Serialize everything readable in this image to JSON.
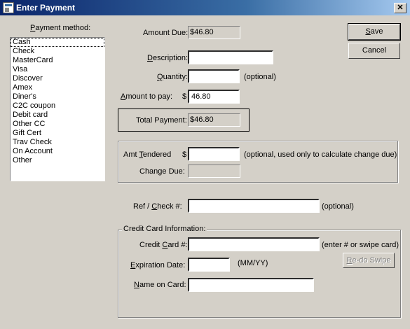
{
  "window": {
    "title": "Enter Payment",
    "close_label": "✕"
  },
  "payment_method": {
    "label": "Payment method:",
    "selected": "Cash",
    "items": [
      "Cash",
      "Check",
      "MasterCard",
      "Visa",
      "Discover",
      "Amex",
      "Diner's",
      "C2C coupon",
      "Debit card",
      "Other CC",
      "Gift Cert",
      "Trav Check",
      "On Account",
      "Other"
    ]
  },
  "amount_due": {
    "label": "Amount Due:",
    "value": "$46.80"
  },
  "description": {
    "label": "Description:",
    "value": ""
  },
  "quantity": {
    "label": "Quantity:",
    "value": "",
    "hint": "(optional)"
  },
  "amount_to_pay": {
    "label": "Amount to pay:",
    "prefix": "$",
    "value": "46.80"
  },
  "total_payment": {
    "label": "Total Payment:",
    "value": "$46.80"
  },
  "tendered": {
    "label": "Amt Tendered",
    "prefix": "$",
    "value": "",
    "hint": "(optional, used only to calculate change due)"
  },
  "change_due": {
    "label": "Change Due:",
    "value": ""
  },
  "ref_check": {
    "label": "Ref / Check #:",
    "value": "",
    "hint": "(optional)"
  },
  "credit_card": {
    "group_label": "Credit Card Information:",
    "number_label": "Credit Card #:",
    "number_value": "",
    "number_hint": "(enter # or swipe card)",
    "exp_label": "Expiration Date:",
    "exp_value": "",
    "exp_hint": "(MM/YY)",
    "name_label": "Name on Card:",
    "name_value": "",
    "reswipe_label": "Re-do Swipe"
  },
  "buttons": {
    "save": "Save",
    "cancel": "Cancel"
  }
}
